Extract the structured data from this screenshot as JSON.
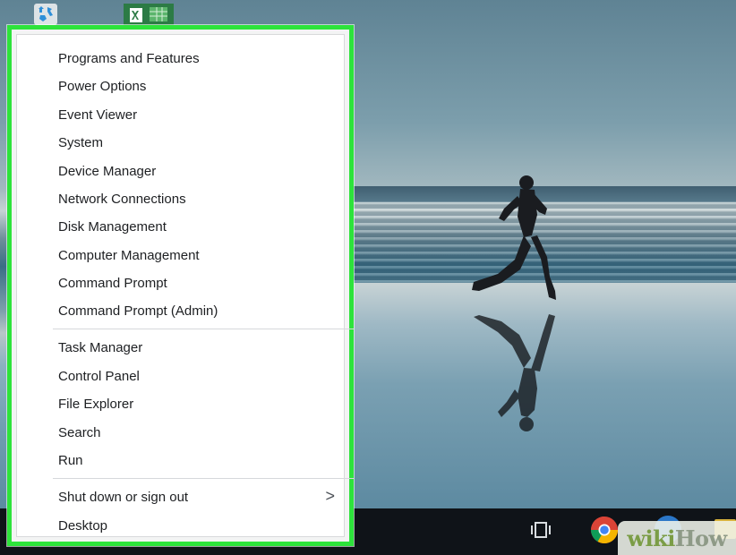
{
  "desktop": {
    "icons": [
      {
        "name": "recycle-bin-icon"
      },
      {
        "name": "excel-icon"
      }
    ]
  },
  "menu": {
    "groups": [
      {
        "items": [
          {
            "label": "Programs and Features"
          },
          {
            "label": "Power Options"
          },
          {
            "label": "Event Viewer"
          },
          {
            "label": "System"
          },
          {
            "label": "Device Manager"
          },
          {
            "label": "Network Connections"
          },
          {
            "label": "Disk Management"
          },
          {
            "label": "Computer Management"
          },
          {
            "label": "Command Prompt"
          },
          {
            "label": "Command Prompt (Admin)"
          }
        ]
      },
      {
        "items": [
          {
            "label": "Task Manager"
          },
          {
            "label": "Control Panel"
          },
          {
            "label": "File Explorer"
          },
          {
            "label": "Search"
          },
          {
            "label": "Run"
          }
        ]
      },
      {
        "items": [
          {
            "label": "Shut down or sign out",
            "submenu_indicator": ">"
          },
          {
            "label": "Desktop"
          }
        ]
      }
    ]
  },
  "taskbar": {
    "icons": [
      "task-view-icon",
      "chrome-icon",
      "edge-icon",
      "file-explorer-icon"
    ]
  },
  "watermark": {
    "part1": "wiki",
    "part2": "How"
  },
  "colors": {
    "highlight_border": "#2de33b",
    "menu_bg": "#ffffff",
    "taskbar_bg": "#0f1318"
  }
}
